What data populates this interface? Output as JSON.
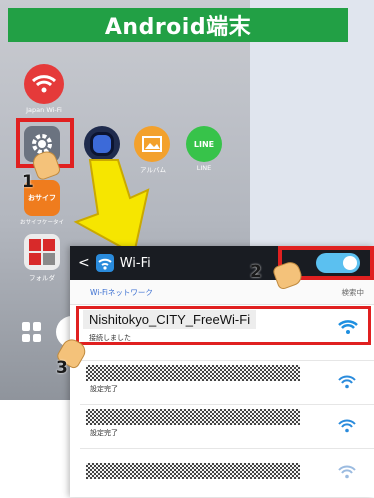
{
  "banner": {
    "title": "Android端末"
  },
  "home_screen": {
    "apps": [
      {
        "label": "Japan Wi-Fi",
        "icon": "japan-wifi-icon"
      },
      {
        "label": "",
        "icon": "settings-gear-icon"
      },
      {
        "label": "",
        "icon": "camera-icon"
      },
      {
        "label": "アルバム",
        "icon": "album-icon"
      },
      {
        "label": "LINE",
        "icon": "line-icon"
      },
      {
        "label": "おサイフケータイ",
        "icon": "osaifu-icon"
      },
      {
        "label": "フォルダ",
        "icon": "folder-icon"
      }
    ],
    "line_text": "LINE",
    "osaifu_text": "おサイフ"
  },
  "wifi_screen": {
    "back_label": "<",
    "title": "Wi-Fi",
    "toggle_state": "on",
    "section_label": "Wi-Fiネットワーク",
    "scanning_label": "検索中",
    "selected_network": {
      "ssid": "Nishitokyo_CITY_FreeWi-Fi",
      "status": "接続しました"
    },
    "other_networks": [
      {
        "status": "設定完了"
      },
      {
        "status": "設定完了"
      },
      {
        "status": ""
      }
    ]
  },
  "steps": [
    "1",
    "2",
    "3"
  ],
  "colors": {
    "banner": "#22a045",
    "highlight": "#e02020",
    "arrow": "#f6e600",
    "toggle": "#5bc0f0"
  }
}
